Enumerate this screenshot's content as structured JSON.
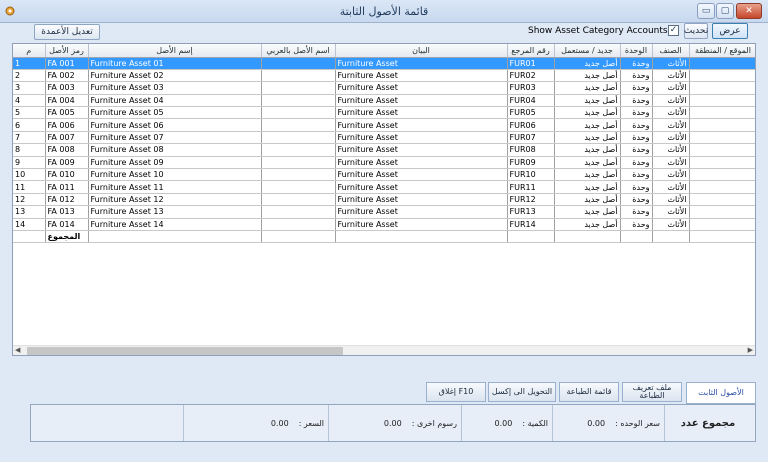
{
  "window": {
    "title": "قائمة الأصول الثابتة",
    "buttons": {
      "minimize": "▭",
      "restore": "▢",
      "close": "✕"
    }
  },
  "toolbar": {
    "show_label": "عرض",
    "refresh_label": "تحديث",
    "show_category_label": "Show Asset Category Accounts",
    "show_category_checked": "✓",
    "edit_columns_label": "تعديل الأعمدة"
  },
  "grid": {
    "columns": [
      "م",
      "رمز الأصل",
      "إسم الأصل",
      "اسم الأصل بالعربي",
      "البيان",
      "رقم المرجع",
      "جديد / مستعمل",
      "الوحدة",
      "الصنف",
      "الموقع / المنطقة"
    ],
    "rows": [
      {
        "n": "1",
        "code": "FA 001",
        "name": "Furniture Asset 01",
        "arabic": "",
        "desc": "Furniture Asset",
        "ref": "FUR01",
        "cond": "أصل جديد",
        "unit": "وحدة",
        "cat": "الأثاث",
        "loc": ""
      },
      {
        "n": "2",
        "code": "FA 002",
        "name": "Furniture Asset 02",
        "arabic": "",
        "desc": "Furniture Asset",
        "ref": "FUR02",
        "cond": "أصل جديد",
        "unit": "وحدة",
        "cat": "الأثاث",
        "loc": ""
      },
      {
        "n": "3",
        "code": "FA 003",
        "name": "Furniture Asset 03",
        "arabic": "",
        "desc": "Furniture Asset",
        "ref": "FUR03",
        "cond": "أصل جديد",
        "unit": "وحدة",
        "cat": "الأثاث",
        "loc": ""
      },
      {
        "n": "4",
        "code": "FA 004",
        "name": "Furniture Asset 04",
        "arabic": "",
        "desc": "Furniture Asset",
        "ref": "FUR04",
        "cond": "أصل جديد",
        "unit": "وحدة",
        "cat": "الأثاث",
        "loc": ""
      },
      {
        "n": "5",
        "code": "FA 005",
        "name": "Furniture Asset 05",
        "arabic": "",
        "desc": "Furniture Asset",
        "ref": "FUR05",
        "cond": "أصل جديد",
        "unit": "وحدة",
        "cat": "الأثاث",
        "loc": ""
      },
      {
        "n": "6",
        "code": "FA 006",
        "name": "Furniture Asset 06",
        "arabic": "",
        "desc": "Furniture Asset",
        "ref": "FUR06",
        "cond": "أصل جديد",
        "unit": "وحدة",
        "cat": "الأثاث",
        "loc": ""
      },
      {
        "n": "7",
        "code": "FA 007",
        "name": "Furniture Asset 07",
        "arabic": "",
        "desc": "Furniture Asset",
        "ref": "FUR07",
        "cond": "أصل جديد",
        "unit": "وحدة",
        "cat": "الأثاث",
        "loc": ""
      },
      {
        "n": "8",
        "code": "FA 008",
        "name": "Furniture Asset 08",
        "arabic": "",
        "desc": "Furniture Asset",
        "ref": "FUR08",
        "cond": "أصل جديد",
        "unit": "وحدة",
        "cat": "الأثاث",
        "loc": ""
      },
      {
        "n": "9",
        "code": "FA 009",
        "name": "Furniture Asset 09",
        "arabic": "",
        "desc": "Furniture Asset",
        "ref": "FUR09",
        "cond": "أصل جديد",
        "unit": "وحدة",
        "cat": "الأثاث",
        "loc": ""
      },
      {
        "n": "10",
        "code": "FA 010",
        "name": "Furniture Asset 10",
        "arabic": "",
        "desc": "Furniture Asset",
        "ref": "FUR10",
        "cond": "أصل جديد",
        "unit": "وحدة",
        "cat": "الأثاث",
        "loc": ""
      },
      {
        "n": "11",
        "code": "FA 011",
        "name": "Furniture Asset 11",
        "arabic": "",
        "desc": "Furniture Asset",
        "ref": "FUR11",
        "cond": "أصل جديد",
        "unit": "وحدة",
        "cat": "الأثاث",
        "loc": ""
      },
      {
        "n": "12",
        "code": "FA 012",
        "name": "Furniture Asset 12",
        "arabic": "",
        "desc": "Furniture Asset",
        "ref": "FUR12",
        "cond": "أصل جديد",
        "unit": "وحدة",
        "cat": "الأثاث",
        "loc": ""
      },
      {
        "n": "13",
        "code": "FA 013",
        "name": "Furniture Asset 13",
        "arabic": "",
        "desc": "Furniture Asset",
        "ref": "FUR13",
        "cond": "أصل جديد",
        "unit": "وحدة",
        "cat": "الأثاث",
        "loc": ""
      },
      {
        "n": "14",
        "code": "FA 014",
        "name": "Furniture Asset 14",
        "arabic": "",
        "desc": "Furniture Asset",
        "ref": "FUR14",
        "cond": "أصل جديد",
        "unit": "وحدة",
        "cat": "الأثاث",
        "loc": ""
      }
    ],
    "total_label": "المجموع"
  },
  "tabs": {
    "fixed_assets": "الأصول الثابت",
    "print_definition": "ملف تعريف الطباعة",
    "print_list": "قائمة الطباعة",
    "export_excel": "التحويل الى إكسل",
    "close": "إغلاق F10"
  },
  "summary": {
    "count_label": "مجموع عدد",
    "unit_price_label": "سعر الوحده :",
    "unit_price_value": "0.00",
    "quantity_label": "الكمية :",
    "quantity_value": "0.00",
    "other_fees_label": "رسوم اخرى :",
    "other_fees_value": "0.00",
    "price_label": "السعر :",
    "price_value": "0.00"
  }
}
